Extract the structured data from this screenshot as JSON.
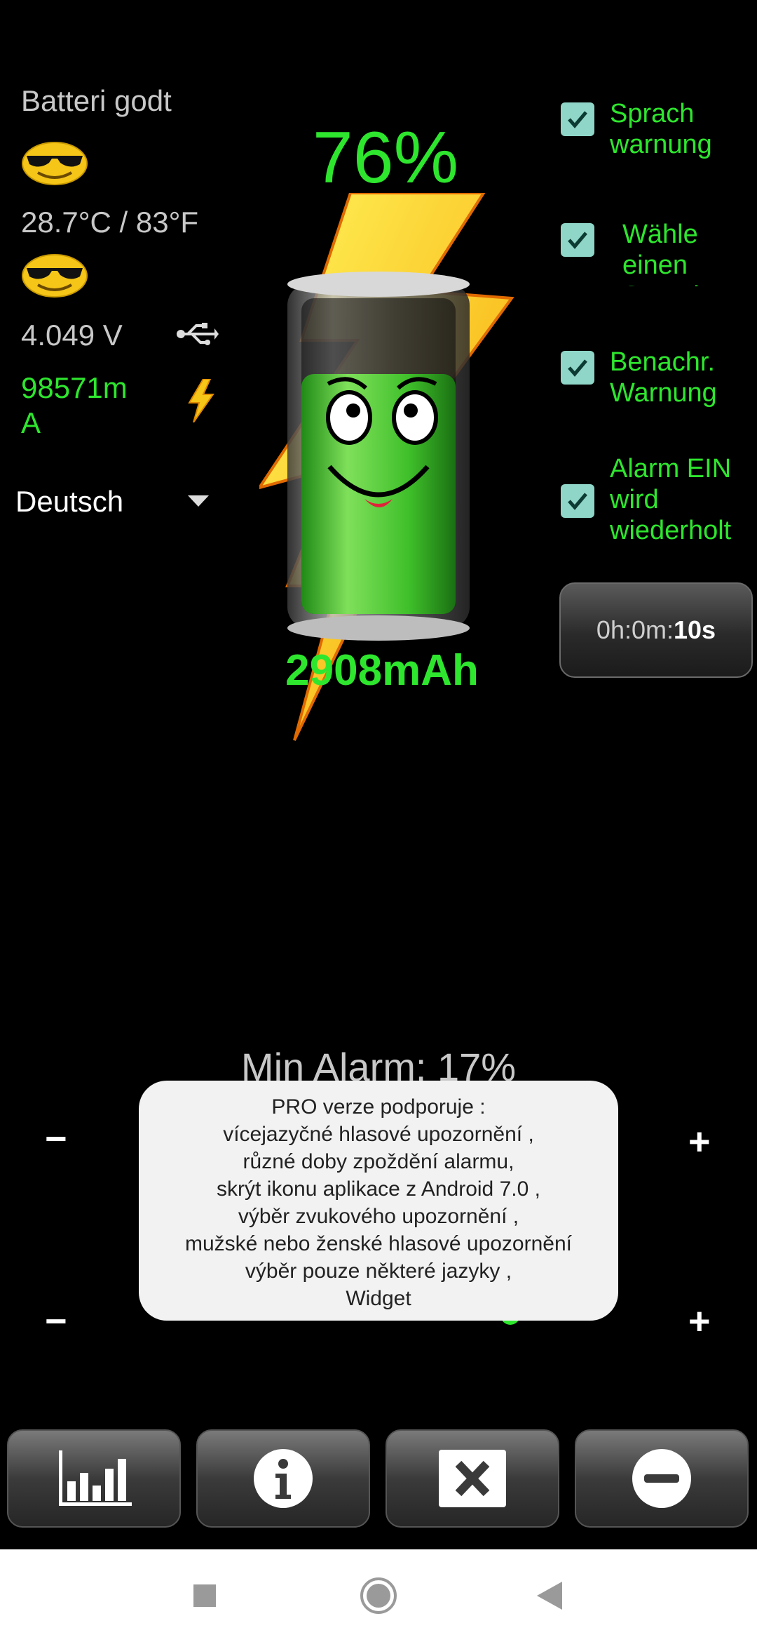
{
  "status": {
    "battery_state": "Batteri godt",
    "temperature": "28.7°C / 83°F",
    "voltage": "4.049 V",
    "current": "98571m A"
  },
  "language_select": {
    "value": "Deutsch"
  },
  "battery": {
    "percent_text": "76%",
    "capacity_text": "2908mAh",
    "level": 0.76
  },
  "options": [
    {
      "label": "Sprach warnung",
      "checked": true
    },
    {
      "label": "Wähle einen Sound",
      "checked": true
    },
    {
      "label": "Benachr. Warnung",
      "checked": true
    },
    {
      "label": "Alarm EIN wird wiederholt",
      "checked": true
    }
  ],
  "timer": {
    "prefix": "0h:0m:",
    "seconds": "10s"
  },
  "min_alarm": {
    "label": "Min Alarm: 17%",
    "minus": "−",
    "plus": "+"
  },
  "max_alarm": {
    "minus": "−",
    "plus": "+"
  },
  "toast_lines": [
    "PRO verze podporuje :",
    "vícejazyčné hlasové upozornění ,",
    "různé doby zpoždění alarmu,",
    "skrýt ikonu aplikace z Android 7.0 ,",
    "výběr zvukového upozornění ,",
    "mužské nebo ženské hlasové upozornění",
    "výběr pouze některé jazyky ,",
    "Widget"
  ],
  "toolbar_icons": [
    "chart-icon",
    "info-icon",
    "close-icon",
    "minus-circle-icon"
  ],
  "colors": {
    "accent_green": "#2ee62e",
    "checkbox": "#8fd6c8",
    "background": "#000000"
  }
}
